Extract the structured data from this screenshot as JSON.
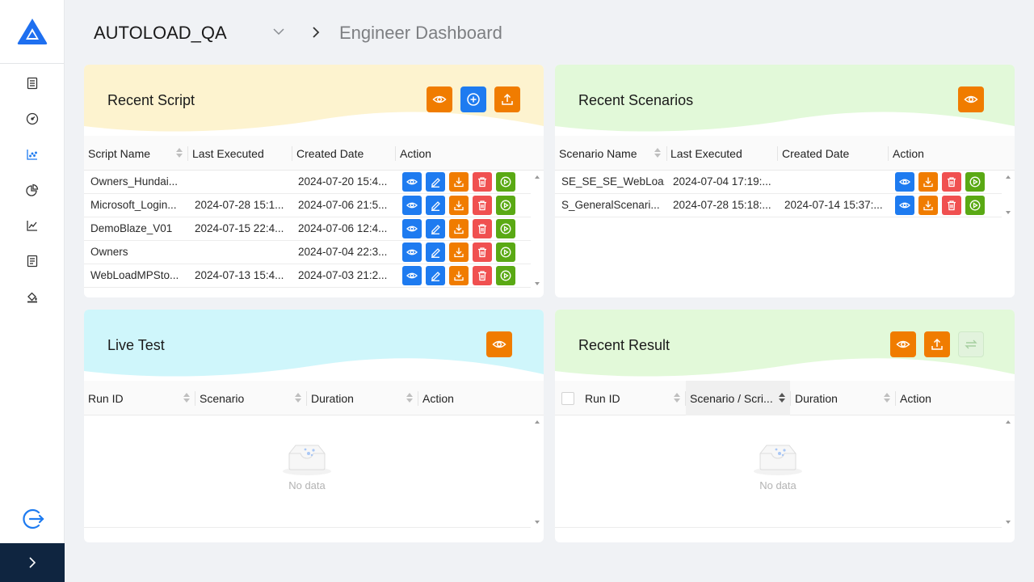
{
  "header": {
    "project": "AUTOLOAD_QA",
    "page": "Engineer Dashboard"
  },
  "sidebar": {
    "items": [
      {
        "icon": "document-list-icon"
      },
      {
        "icon": "dashboard-gauge-icon"
      },
      {
        "icon": "scatter-chart-icon",
        "active": true
      },
      {
        "icon": "pie-chart-icon"
      },
      {
        "icon": "line-chart-icon"
      },
      {
        "icon": "report-icon"
      },
      {
        "icon": "paint-bucket-icon"
      }
    ],
    "logout_icon": "logout-icon",
    "collapse_icon": "chevron-right-icon"
  },
  "colors": {
    "accent_blue": "#1e7bf0",
    "accent_orange": "#f07c00",
    "danger_red": "#f05050",
    "success_green": "#5aa914",
    "sidebar_bottom": "#0f2540",
    "script_header": "#fdf3cf",
    "scenario_header": "#e2f9d9",
    "live_header": "#cff6fb",
    "result_header": "#e2f9d9"
  },
  "recent_script": {
    "title": "Recent Script",
    "columns": [
      "Script Name",
      "Last Executed",
      "Created Date",
      "Action"
    ],
    "rows": [
      {
        "name": "Owners_Hundai...",
        "last": "",
        "created": "2024-07-20 15:4..."
      },
      {
        "name": "Microsoft_Login...",
        "last": "2024-07-28 15:1...",
        "created": "2024-07-06 21:5..."
      },
      {
        "name": "DemoBlaze_V01",
        "last": "2024-07-15 22:4...",
        "created": "2024-07-06 12:4..."
      },
      {
        "name": "Owners",
        "last": "",
        "created": "2024-07-04 22:3..."
      },
      {
        "name": "WebLoadMPSto...",
        "last": "2024-07-13 15:4...",
        "created": "2024-07-03 21:2..."
      }
    ]
  },
  "recent_scenarios": {
    "title": "Recent Scenarios",
    "columns": [
      "Scenario Name",
      "Last Executed",
      "Created Date",
      "Action"
    ],
    "rows": [
      {
        "name": "SE_SE_SE_WebLoa...",
        "last": "2024-07-04 17:19:...",
        "created": ""
      },
      {
        "name": "S_GeneralScenari...",
        "last": "2024-07-28 15:18:...",
        "created": "2024-07-14 15:37:..."
      }
    ]
  },
  "live_test": {
    "title": "Live Test",
    "columns": [
      "Run ID",
      "Scenario",
      "Duration",
      "Action"
    ],
    "empty_text": "No data"
  },
  "recent_result": {
    "title": "Recent Result",
    "columns": [
      "Run ID",
      "Scenario / Scri...",
      "Duration",
      "Action"
    ],
    "empty_text": "No data"
  }
}
